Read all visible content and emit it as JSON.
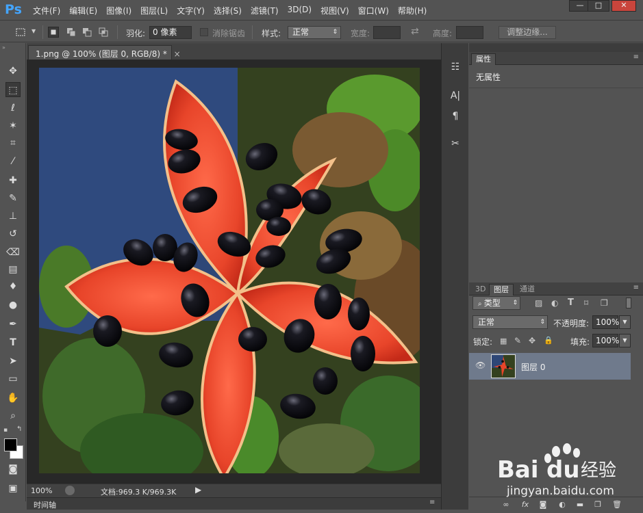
{
  "app": {
    "logo": "Ps"
  },
  "menu": [
    "文件(F)",
    "编辑(E)",
    "图像(I)",
    "图层(L)",
    "文字(Y)",
    "选择(S)",
    "滤镜(T)",
    "3D(D)",
    "视图(V)",
    "窗口(W)",
    "帮助(H)"
  ],
  "window_controls": {
    "minimize": "—",
    "maximize": "□",
    "close": "✕"
  },
  "options": {
    "feather_label": "羽化:",
    "feather_value": "0 像素",
    "antialias_label": "消除锯齿",
    "style_label": "样式:",
    "style_value": "正常",
    "width_label": "宽度:",
    "height_label": "高度:",
    "refine_edge": "调整边缘..."
  },
  "document": {
    "tab_title": "1.png @ 100% (图层 0, RGB/8) *",
    "tab_close": "×",
    "zoom": "100%",
    "doc_info": "文档:969.3 K/969.3K"
  },
  "timeline": {
    "label": "时间轴"
  },
  "properties": {
    "tab": "属性",
    "empty_text": "无属性"
  },
  "layers": {
    "tabs": [
      "3D",
      "图层",
      "通道"
    ],
    "filter_label": "类型",
    "blend_mode": "正常",
    "opacity_label": "不透明度:",
    "opacity_value": "100%",
    "lock_label": "锁定:",
    "fill_label": "填充:",
    "fill_value": "100%",
    "layer_name": "图层 0"
  },
  "watermark": {
    "brand": "Bai",
    "brand2": "du",
    "suffix": "经验",
    "url": "jingyan.baidu.com"
  },
  "colors": {
    "accent": "#44a5ff",
    "panel": "#535353",
    "selected_layer": "#6f7a8c"
  }
}
